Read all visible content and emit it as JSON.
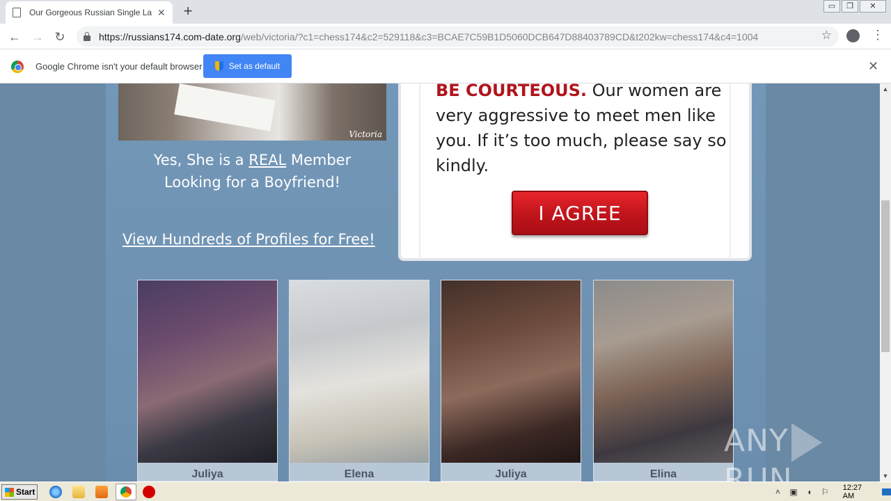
{
  "browser": {
    "tab_title": "Our Gorgeous Russian Single Ladies",
    "tab_close": "✕",
    "new_tab": "+",
    "window_controls": {
      "minimize": "▭",
      "restore": "❐",
      "close": "✕"
    },
    "url_host": "https://russians174.com-date.org",
    "url_path": "/web/victoria/?c1=chess174&c2=529118&c3=BCAE7C59B1D5060DCB647D88403789CD&t202kw=chess174&c4=1004",
    "nav_back": "←",
    "nav_forward": "→",
    "nav_reload": "↻",
    "bookmark_star": "☆",
    "menu": "⋮"
  },
  "infobar": {
    "message": "Google Chrome isn't your default browser",
    "button_label": "Set as default",
    "close": "✕"
  },
  "page": {
    "hero_watermark": "Victoria",
    "caption_pre": "Yes, She is a ",
    "caption_real": "REAL",
    "caption_post": " Member",
    "caption_line2": "Looking for a Boyfriend!",
    "profiles_link": "View Hundreds of Profiles for Free!",
    "modal_emphasis": "BE COURTEOUS.",
    "modal_text": " Our women are very aggressive to meet men like you. If it’s too much, please say so kindly.",
    "agree_button": "I AGREE",
    "profiles": [
      {
        "name": "Juliya"
      },
      {
        "name": "Elena"
      },
      {
        "name": "Juliya"
      },
      {
        "name": "Elina"
      }
    ],
    "watermark_left": "ANY",
    "watermark_right": "RUN"
  },
  "scrollbar": {
    "up": "▲",
    "down": "▼"
  },
  "taskbar": {
    "start_label": "Start",
    "clock": "12:27 AM",
    "tray_icons": [
      "chevron-up-icon",
      "network-icon",
      "volume-icon",
      "flag-icon"
    ]
  }
}
